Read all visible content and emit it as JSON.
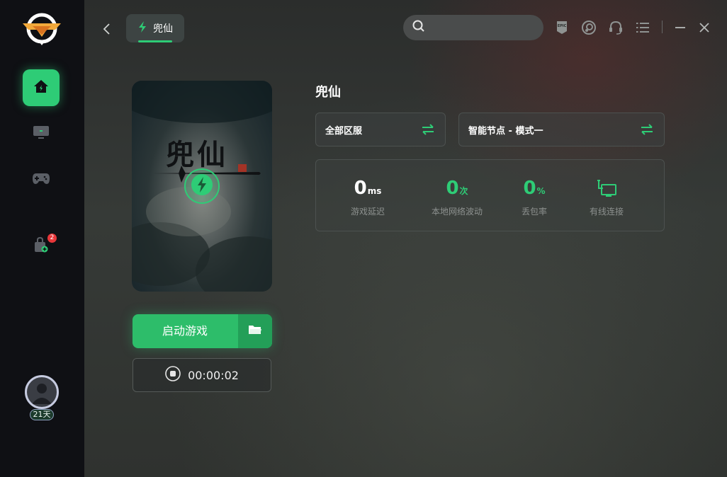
{
  "sidebar": {
    "items": [
      {
        "name": "home",
        "icon": "home-icon",
        "active": true
      },
      {
        "name": "monitor",
        "icon": "monitor-icon",
        "active": false
      },
      {
        "name": "gamepad",
        "icon": "gamepad-icon",
        "active": false
      },
      {
        "name": "store",
        "icon": "bag-icon",
        "active": false,
        "badge": "2"
      }
    ],
    "user": {
      "days": "21天"
    }
  },
  "header": {
    "back": "back-arrow-icon",
    "tab_label": "兜仙",
    "search": {
      "placeholder": "",
      "value": ""
    },
    "icons": [
      "epic-icon",
      "steam-icon",
      "headset-icon",
      "menu-icon",
      "minimize-icon",
      "close-icon"
    ]
  },
  "game": {
    "title": "兜仙",
    "cover_title": "兜仙",
    "launch_label": "启动游戏",
    "timer": "00:00:02"
  },
  "region": {
    "label": "全部区服"
  },
  "node": {
    "label": "智能节点 - 模式一"
  },
  "stats": {
    "latency": {
      "value": "0",
      "unit": "ms",
      "label": "游戏延迟"
    },
    "jitter": {
      "value": "0",
      "unit": "次",
      "label": "本地网络波动"
    },
    "loss": {
      "value": "0",
      "unit": "%",
      "label": "丢包率"
    },
    "connection": {
      "label": "有线连接"
    }
  },
  "colors": {
    "accent": "#2ecc76",
    "sidebar": "#0f1014",
    "badge": "#e8373a"
  }
}
